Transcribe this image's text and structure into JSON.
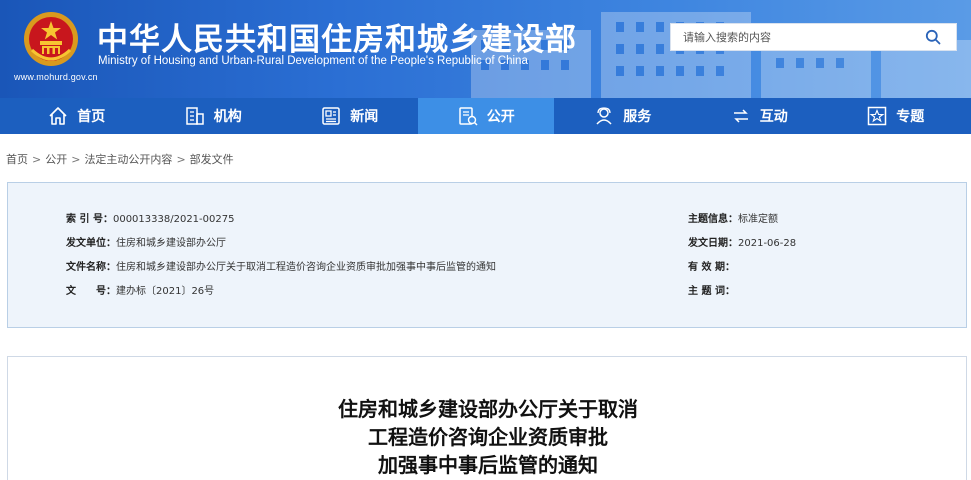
{
  "header": {
    "title": "中华人民共和国住房和城乡建设部",
    "subtitle": "Ministry of Housing and Urban-Rural Development of the People's Republic of China",
    "url": "www.mohurd.gov.cn",
    "emblem_icon": "national-emblem-icon",
    "colors": {
      "banner": "#1a56b8",
      "nav": "#1c5fbf",
      "nav_active": "#3d8fe6"
    }
  },
  "search": {
    "placeholder": "请输入搜索的内容",
    "button_icon": "search-icon"
  },
  "nav": {
    "items": [
      {
        "label": "首页",
        "icon": "home-icon"
      },
      {
        "label": "机构",
        "icon": "building-icon"
      },
      {
        "label": "新闻",
        "icon": "news-icon"
      },
      {
        "label": "公开",
        "icon": "document-icon",
        "active": true
      },
      {
        "label": "服务",
        "icon": "service-icon"
      },
      {
        "label": "互动",
        "icon": "interaction-icon"
      },
      {
        "label": "专题",
        "icon": "star-icon"
      }
    ]
  },
  "breadcrumb": {
    "items": [
      "首页",
      "公开",
      "法定主动公开内容",
      "部发文件"
    ],
    "separator": ">"
  },
  "meta": {
    "index_no_label": "索 引 号：",
    "index_no": "000013338/2021-00275",
    "issuer_label": "发文单位：",
    "issuer": "住房和城乡建设部办公厅",
    "filename_label": "文件名称：",
    "filename": "住房和城乡建设部办公厅关于取消工程造价咨询企业资质审批加强事中事后监管的通知",
    "doc_no_label": "文　　号：",
    "doc_no": "建办标〔2021〕26号",
    "topic_label": "主题信息：",
    "topic": "标准定额",
    "date_label": "发文日期：",
    "date": "2021-06-28",
    "validity_label": "有 效 期：",
    "validity": "",
    "keywords_label": "主 题 词：",
    "keywords": ""
  },
  "article": {
    "title_line1": "住房和城乡建设部办公厅关于取消",
    "title_line2": "工程造价咨询企业资质审批",
    "title_line3": "加强事中事后监管的通知"
  }
}
